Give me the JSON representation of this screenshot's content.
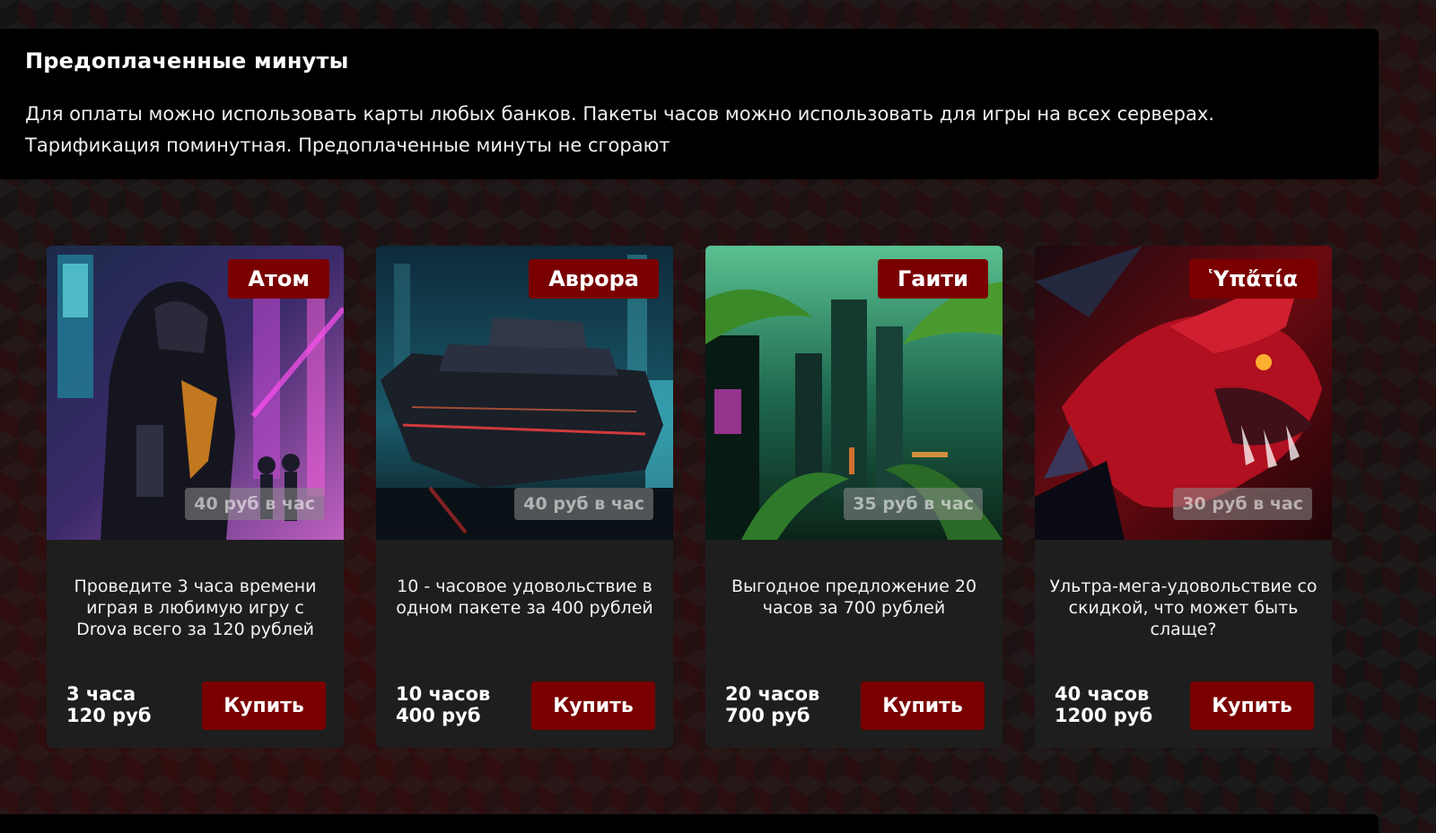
{
  "section": {
    "title": "Предоплаченные минуты",
    "description_line1": "Для оплаты можно использовать карты любых банков. Пакеты часов можно использовать для игры на всех серверах.",
    "description_line2": "Тарификация поминутная. Предоплаченные минуты не сгорают"
  },
  "cards": [
    {
      "server": "Атом",
      "rate": "40 руб в час",
      "description": "Проведите 3 часа времени играя в любимую игру с Drova всего за 120 рублей",
      "hours": "3 часа",
      "price": "120 руб",
      "button": "Купить"
    },
    {
      "server": "Аврора",
      "rate": "40 руб в час",
      "description": "10 - часовое удовольствие в одном пакете за 400 рублей",
      "hours": "10 часов",
      "price": "400 руб",
      "button": "Купить"
    },
    {
      "server": "Гаити",
      "rate": "35 руб в час",
      "description": "Выгодное предложение 20 часов за 700 рублей",
      "hours": "20 часов",
      "price": "700 руб",
      "button": "Купить"
    },
    {
      "server": "Ὑπἄτία",
      "rate": "30 руб в час",
      "description": "Ультра-мега-удовольствие со скидкой, что может быть слаще?",
      "hours": "40 часов",
      "price": "1200 руб",
      "button": "Купить"
    }
  ],
  "colors": {
    "accent": "#7a0000",
    "card_bg": "#1e1e1e",
    "panel_bg": "#000000"
  }
}
